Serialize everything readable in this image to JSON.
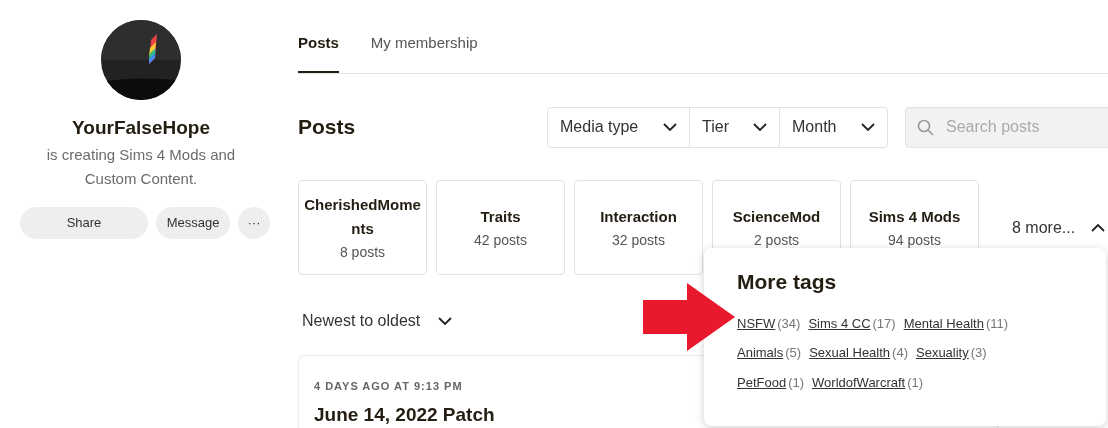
{
  "creator": {
    "name": "YourFalseHope",
    "tagline": "is creating Sims 4 Mods and Custom Content.",
    "buttons": [
      {
        "kind": "share",
        "label": "Share"
      },
      {
        "kind": "message",
        "label": "Message"
      },
      {
        "kind": "more",
        "label": "···"
      }
    ]
  },
  "tabs": [
    {
      "label": "Posts",
      "selected": true
    },
    {
      "label": "My membership",
      "selected": false
    }
  ],
  "posts_heading": "Posts",
  "filters": [
    "Media type",
    "Tier",
    "Month"
  ],
  "search": {
    "placeholder": "Search posts"
  },
  "tags": [
    {
      "name": "CherishedMoments",
      "count": "8 posts"
    },
    {
      "name": "Traits",
      "count": "42 posts"
    },
    {
      "name": "Interaction",
      "count": "32 posts"
    },
    {
      "name": "ScienceMod",
      "count": "2 posts"
    },
    {
      "name": "Sims 4 Mods",
      "count": "94 posts"
    }
  ],
  "more_toggle": {
    "label": "8 more...",
    "expanded": true
  },
  "more_tags": {
    "title": "More tags",
    "rows": [
      [
        {
          "name": "NSFW",
          "count": "(34)"
        },
        {
          "name": "Sims 4 CC",
          "count": "(17)"
        },
        {
          "name": "Mental Health",
          "count": "(11)"
        }
      ],
      [
        {
          "name": "Animals",
          "count": "(5)"
        },
        {
          "name": "Sexual Health",
          "count": "(4)"
        },
        {
          "name": "Sexuality",
          "count": "(3)"
        }
      ],
      [
        {
          "name": "PetFood",
          "count": "(1)"
        },
        {
          "name": "WorldofWarcraft",
          "count": "(1)"
        }
      ]
    ]
  },
  "sort": {
    "label": "Newest to oldest"
  },
  "post": {
    "time": "4 DAYS AGO AT 9:13 PM",
    "title": "June 14, 2022 Patch"
  }
}
